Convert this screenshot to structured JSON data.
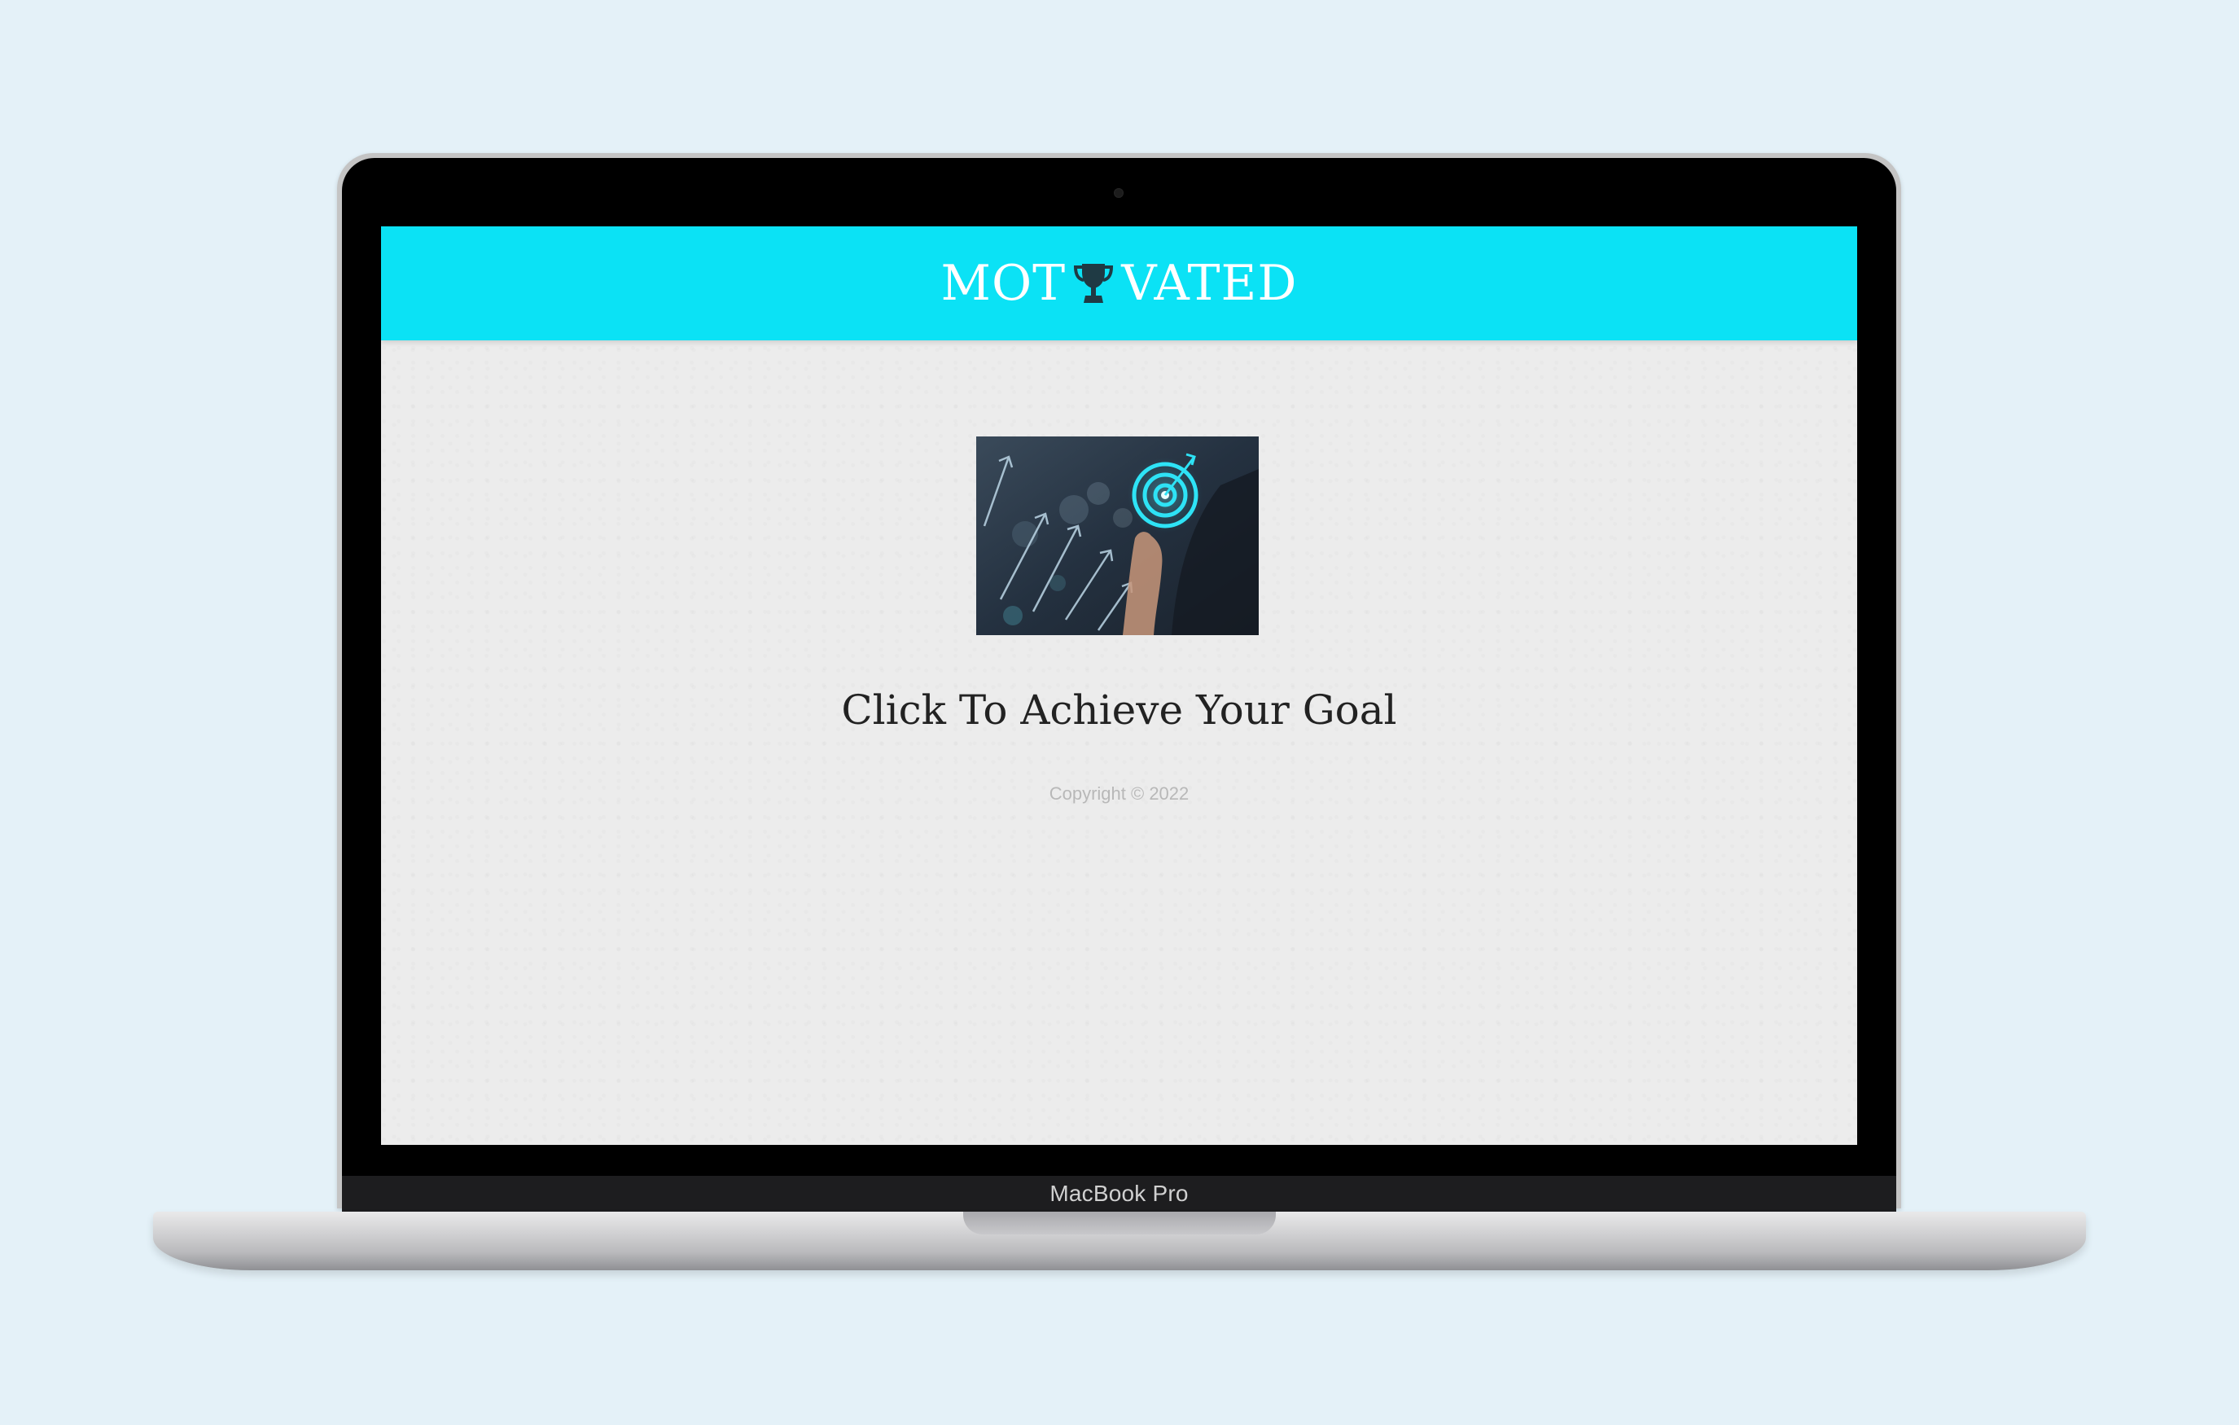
{
  "site": {
    "logo_left": "MOT",
    "logo_icon": "trophy-icon",
    "logo_right": "VATED",
    "header_color": "#0be2f5"
  },
  "hero": {
    "image_alt": "target-goal-image"
  },
  "main": {
    "cta_text": "Click To Achieve Your Goal",
    "copyright": "Copyright © 2022"
  },
  "device": {
    "model_label": "MacBook Pro"
  }
}
